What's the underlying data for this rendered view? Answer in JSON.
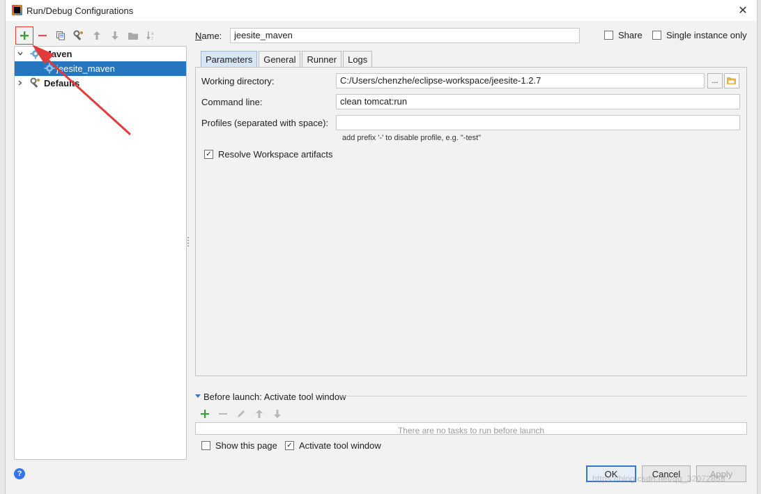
{
  "window": {
    "title": "Run/Debug Configurations",
    "close_glyph": "✕"
  },
  "toolbar": {
    "buttons": [
      {
        "name": "add",
        "icon": "plus-icon"
      },
      {
        "name": "remove",
        "icon": "minus-icon"
      },
      {
        "name": "copy",
        "icon": "copy-icon"
      },
      {
        "name": "edit-defaults",
        "icon": "wrench-icon"
      },
      {
        "name": "move-up",
        "icon": "arrow-up-icon"
      },
      {
        "name": "move-down",
        "icon": "arrow-down-icon"
      },
      {
        "name": "folder",
        "icon": "folder-icon"
      },
      {
        "name": "sort",
        "icon": "sort-alpha-icon"
      }
    ]
  },
  "tree": {
    "items": [
      {
        "label": "Maven",
        "bold": true,
        "expanded": true,
        "icon": "maven-gear-icon"
      },
      {
        "label": "jeesite_maven",
        "selected": true,
        "icon": "maven-gear-icon"
      },
      {
        "label": "Defaults",
        "bold": true,
        "expanded": false,
        "icon": "wrench-gear-icon"
      }
    ]
  },
  "form": {
    "name_label": "Name:",
    "name_value": "jeesite_maven",
    "share_label": "Share",
    "single_instance_label": "Single instance only",
    "share_checked": false,
    "single_instance_checked": false
  },
  "tabs": [
    "Parameters",
    "General",
    "Runner",
    "Logs"
  ],
  "active_tab": "Parameters",
  "parameters": {
    "working_dir_label": "Working directory:",
    "working_dir_value": "C:/Users/chenzhe/eclipse-workspace/jeesite-1.2.7",
    "browse_label": "...",
    "command_line_label": "Command line:",
    "command_line_value": "clean tomcat:run",
    "profiles_label": "Profiles (separated with space):",
    "profiles_value": "",
    "profiles_hint": "add prefix '-' to disable profile, e.g. \"-test\"",
    "resolve_label": "Resolve Workspace artifacts",
    "resolve_checked": true
  },
  "before_launch": {
    "title": "Before launch: Activate tool window",
    "empty_text": "There are no tasks to run before launch",
    "tools": [
      "add",
      "remove",
      "edit",
      "move-up",
      "move-down"
    ]
  },
  "footer": {
    "show_page_label": "Show this page",
    "show_page_checked": false,
    "activate_label": "Activate tool window",
    "activate_checked": true,
    "ok_label": "OK",
    "cancel_label": "Cancel",
    "apply_label": "Apply",
    "help_glyph": "?"
  },
  "watermark": "https://blog.csdn.net/qq_32072853",
  "colors": {
    "selection": "#2675bf",
    "accent_add": "#3c9e3c",
    "accent_remove": "#d9534f",
    "annotation": "#e23b3b"
  }
}
